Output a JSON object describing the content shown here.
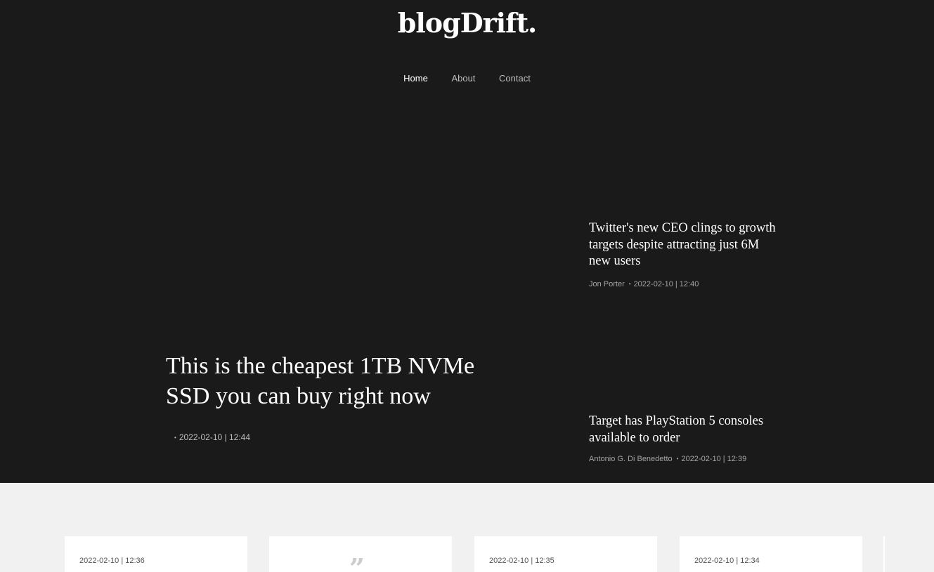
{
  "site": {
    "logo": "blogDrift."
  },
  "nav": {
    "items": [
      "Home",
      "About",
      "Contact"
    ]
  },
  "featured": {
    "title": "This is the cheapest 1TB NVMe SSD you can buy right now",
    "separator": "•",
    "date": "2022-02-10 | 12:44"
  },
  "side_posts": [
    {
      "title": "Twitter's new CEO clings to growth targets despite attracting just 6M new users",
      "author": "Jon Porter",
      "separator": "•",
      "date": "2022-02-10 | 12:40"
    },
    {
      "title": "Target has PlayStation 5 consoles available to order",
      "author": "Antonio G. Di Benedetto",
      "separator": "•",
      "date": "2022-02-10 | 12:39"
    }
  ],
  "cards": [
    {
      "date": "2022-02-10 | 12:36"
    },
    {
      "quote": "”"
    },
    {
      "date": "2022-02-10 | 12:35"
    },
    {
      "date": "2022-02-10 | 12:34"
    }
  ],
  "colors": {
    "hero_background": "#1a1a1a",
    "page_background": "#f1f1f1",
    "card_background": "#ffffff",
    "text_primary": "#ffffff",
    "text_muted": "#a5a5a5"
  }
}
